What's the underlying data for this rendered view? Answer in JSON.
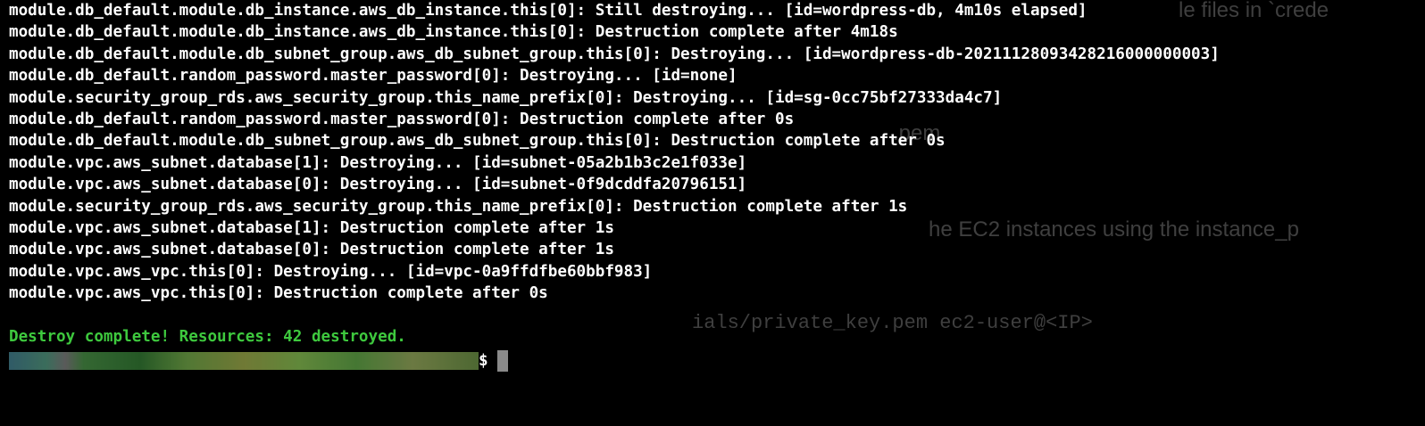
{
  "background_text": [
    "le files in `crede",
    ".pem",
    "he EC2 instances using the instance_p",
    "ials/private_key.pem ec2-user@<IP>"
  ],
  "output_lines": [
    "module.db_default.module.db_instance.aws_db_instance.this[0]: Still destroying... [id=wordpress-db, 4m10s elapsed]",
    "module.db_default.module.db_instance.aws_db_instance.this[0]: Destruction complete after 4m18s",
    "module.db_default.module.db_subnet_group.aws_db_subnet_group.this[0]: Destroying... [id=wordpress-db-20211128093428216000000003]",
    "module.db_default.random_password.master_password[0]: Destroying... [id=none]",
    "module.security_group_rds.aws_security_group.this_name_prefix[0]: Destroying... [id=sg-0cc75bf27333da4c7]",
    "module.db_default.random_password.master_password[0]: Destruction complete after 0s",
    "module.db_default.module.db_subnet_group.aws_db_subnet_group.this[0]: Destruction complete after 0s",
    "module.vpc.aws_subnet.database[1]: Destroying... [id=subnet-05a2b1b3c2e1f033e]",
    "module.vpc.aws_subnet.database[0]: Destroying... [id=subnet-0f9dcddfa20796151]",
    "module.security_group_rds.aws_security_group.this_name_prefix[0]: Destruction complete after 1s",
    "module.vpc.aws_subnet.database[1]: Destruction complete after 1s",
    "module.vpc.aws_subnet.database[0]: Destruction complete after 1s",
    "module.vpc.aws_vpc.this[0]: Destroying... [id=vpc-0a9ffdfbe60bbf983]",
    "module.vpc.aws_vpc.this[0]: Destruction complete after 0s"
  ],
  "summary": "Destroy complete! Resources: 42 destroyed.",
  "prompt": {
    "symbol": "$"
  },
  "colors": {
    "background": "#000000",
    "text": "#ffffff",
    "success": "#3ec93e",
    "cursor": "#8a8a8a"
  }
}
